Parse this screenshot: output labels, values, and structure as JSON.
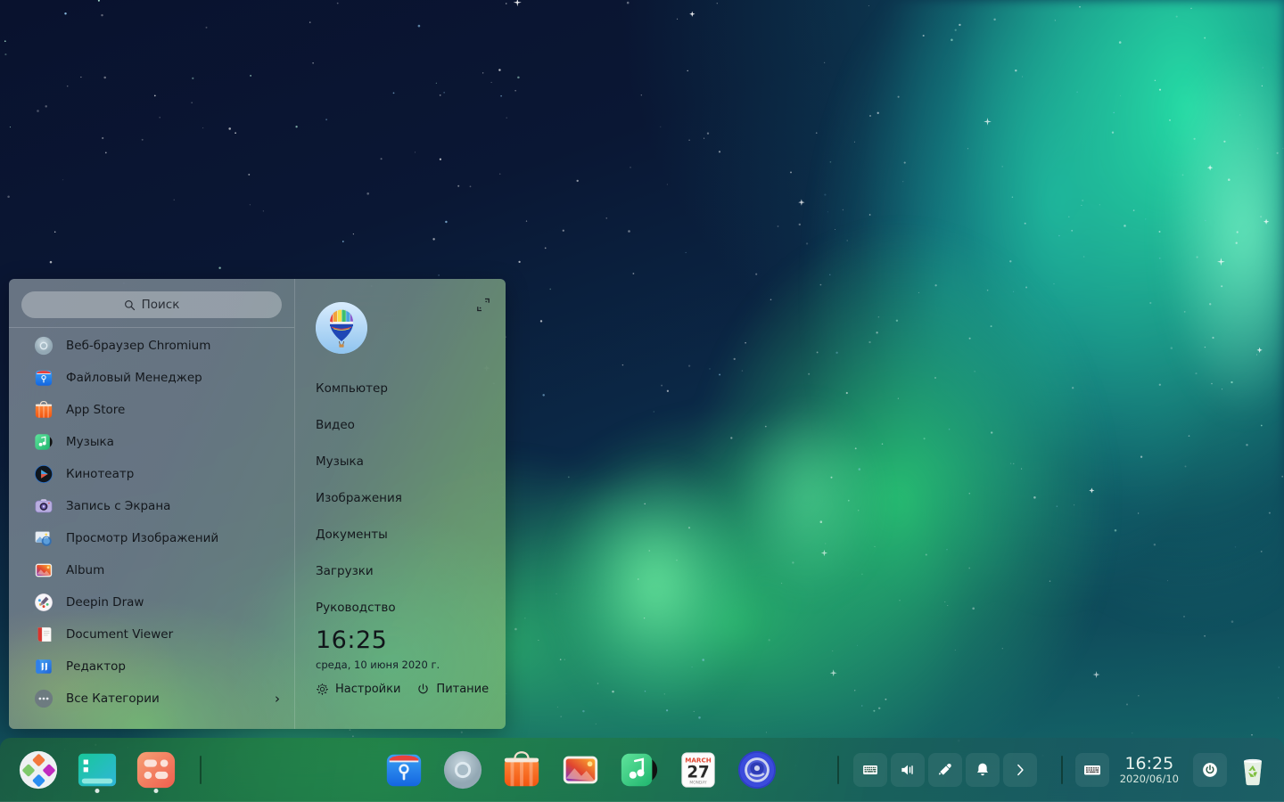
{
  "desktop": {
    "wallpaper_name": "aurora-night-sky",
    "colors": {
      "sky_dark": "#09122e",
      "sky_blue": "#0b2b49",
      "aurora_teal": "#1ec8a8",
      "aurora_green": "#34de70",
      "aurora_bright": "#78ffaa"
    }
  },
  "launcher": {
    "search": {
      "placeholder": "Поиск",
      "icon": "search-icon"
    },
    "fullscreen_toggle_icon": "expand-fullscreen-icon",
    "apps": [
      {
        "label": "Веб-браузер Chromium",
        "icon": "chromium-icon"
      },
      {
        "label": "Файловый Менеджер",
        "icon": "file-manager-icon"
      },
      {
        "label": "App Store",
        "icon": "app-store-icon"
      },
      {
        "label": "Музыка",
        "icon": "music-icon"
      },
      {
        "label": "Кинотеатр",
        "icon": "movie-icon"
      },
      {
        "label": "Запись с Экрана",
        "icon": "screen-recorder-icon"
      },
      {
        "label": "Просмотр Изображений",
        "icon": "image-viewer-icon"
      },
      {
        "label": "Album",
        "icon": "album-icon"
      },
      {
        "label": "Deepin Draw",
        "icon": "draw-icon"
      },
      {
        "label": "Document Viewer",
        "icon": "document-viewer-icon"
      },
      {
        "label": "Редактор",
        "icon": "text-editor-icon"
      }
    ],
    "all_categories": {
      "label": "Все Категории",
      "icon": "more-dots-icon",
      "chevron": "›"
    },
    "avatar_icon": "hot-air-balloon-avatar",
    "places": [
      {
        "label": "Компьютер"
      },
      {
        "label": "Видео"
      },
      {
        "label": "Музыка"
      },
      {
        "label": "Изображения"
      },
      {
        "label": "Документы"
      },
      {
        "label": "Загрузки"
      },
      {
        "label": "Руководство"
      }
    ],
    "clock": "16:25",
    "date": "среда, 10 июня 2020 г.",
    "actions": [
      {
        "label": "Настройки",
        "icon": "gear-icon"
      },
      {
        "label": "Питание",
        "icon": "power-icon"
      }
    ]
  },
  "dock": {
    "left_items": [
      {
        "name": "launcher",
        "icon": "deepin-launcher-icon",
        "running": false
      },
      {
        "name": "terminal",
        "icon": "terminal-icon",
        "running": true
      },
      {
        "name": "control-center",
        "icon": "control-center-icon",
        "running": true
      }
    ],
    "center_items": [
      {
        "name": "file-manager",
        "icon": "file-manager-icon"
      },
      {
        "name": "chromium",
        "icon": "chromium-icon"
      },
      {
        "name": "app-store",
        "icon": "app-store-icon"
      },
      {
        "name": "album",
        "icon": "album-icon"
      },
      {
        "name": "music",
        "icon": "music-icon"
      },
      {
        "name": "calendar",
        "icon": "calendar-icon",
        "month": "MARCH",
        "day": "27",
        "weekday": "MONDAY"
      },
      {
        "name": "settings",
        "icon": "settings-gear-icon"
      }
    ],
    "tray_items": [
      {
        "name": "onboard-keyboard",
        "icon": "keyboard-icon"
      },
      {
        "name": "volume",
        "icon": "volume-icon"
      },
      {
        "name": "color-picker",
        "icon": "eyedropper-icon"
      },
      {
        "name": "notifications",
        "icon": "bell-icon"
      },
      {
        "name": "tray-expand",
        "icon": "chevron-right-icon"
      }
    ],
    "right_items": [
      {
        "name": "input-method",
        "icon": "input-method-keyboard-icon"
      },
      {
        "name": "shutdown",
        "icon": "power-icon"
      },
      {
        "name": "trash",
        "icon": "trash-recycle-icon"
      }
    ],
    "clock": {
      "time": "16:25",
      "date": "2020/06/10"
    }
  }
}
